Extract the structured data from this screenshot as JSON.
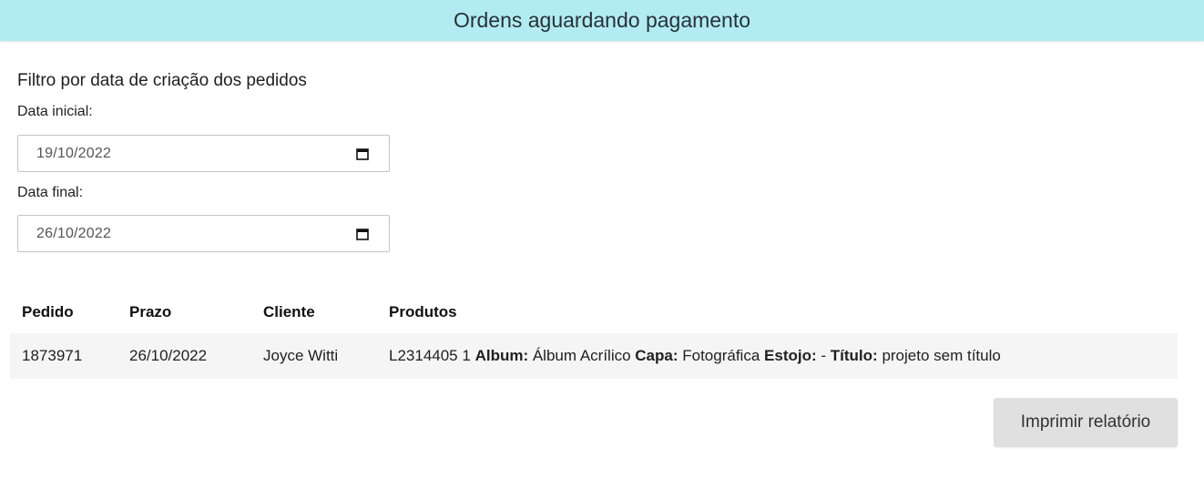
{
  "header": {
    "title": "Ordens aguardando pagamento",
    "background": "#b2ebf2"
  },
  "filter": {
    "heading": "Filtro por data de criação dos pedidos",
    "start_label": "Data inicial:",
    "start_value": "19/10/2022",
    "end_label": "Data final:",
    "end_value": "26/10/2022",
    "icon": "calendar-icon"
  },
  "table": {
    "columns": [
      "Pedido",
      "Prazo",
      "Cliente",
      "Produtos"
    ],
    "rows": [
      {
        "pedido": "1873971",
        "prazo": "26/10/2022",
        "cliente": "Joyce Witti",
        "produtos": {
          "code": "L2314405 1",
          "album_label": "Album:",
          "album_value": "Álbum Acrílico",
          "capa_label": "Capa:",
          "capa_value": "Fotográfica",
          "estojo_label": "Estojo:",
          "estojo_value": "-",
          "titulo_label": "Título:",
          "titulo_value": "projeto sem título"
        }
      }
    ]
  },
  "actions": {
    "print_label": "Imprimir relatório"
  }
}
